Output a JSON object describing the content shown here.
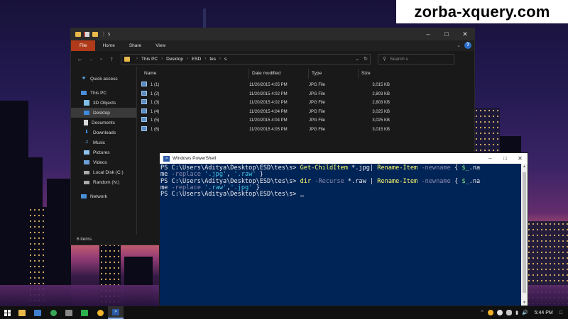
{
  "watermark": "zorba-xquery.com",
  "explorer": {
    "title": "s",
    "ribbon_tabs": [
      "File",
      "Home",
      "Share",
      "View"
    ],
    "help_label": "?",
    "breadcrumb": [
      "This PC",
      "Desktop",
      "ESD",
      "tes",
      "s"
    ],
    "search_placeholder": "Search s",
    "sidebar": [
      {
        "label": "Quick access",
        "icon": "star-icon"
      },
      {
        "label": "This PC",
        "icon": "computer-icon"
      },
      {
        "label": "3D Objects",
        "icon": "cube-icon"
      },
      {
        "label": "Desktop",
        "icon": "desktop-icon",
        "selected": true
      },
      {
        "label": "Documents",
        "icon": "document-icon"
      },
      {
        "label": "Downloads",
        "icon": "download-icon"
      },
      {
        "label": "Music",
        "icon": "music-icon"
      },
      {
        "label": "Pictures",
        "icon": "picture-icon"
      },
      {
        "label": "Videos",
        "icon": "video-icon"
      },
      {
        "label": "Local Disk (C:)",
        "icon": "drive-icon"
      },
      {
        "label": "Random (N:)",
        "icon": "drive-icon"
      },
      {
        "label": "Network",
        "icon": "network-icon"
      }
    ],
    "columns": {
      "name": "Name",
      "date": "Date modified",
      "type": "Type",
      "size": "Size"
    },
    "files": [
      {
        "name": "1 (1)",
        "date": "11/20/2015 4:05 PM",
        "type": "JPG File",
        "size": "3,015 KB"
      },
      {
        "name": "1 (2)",
        "date": "11/20/2015 4:02 PM",
        "type": "JPG File",
        "size": "2,803 KB"
      },
      {
        "name": "1 (3)",
        "date": "11/20/2015 4:02 PM",
        "type": "JPG File",
        "size": "2,803 KB"
      },
      {
        "name": "1 (4)",
        "date": "11/20/2015 4:04 PM",
        "type": "JPG File",
        "size": "3,025 KB"
      },
      {
        "name": "1 (5)",
        "date": "11/20/2015 4:04 PM",
        "type": "JPG File",
        "size": "3,025 KB"
      },
      {
        "name": "1 (6)",
        "date": "11/20/2015 4:05 PM",
        "type": "JPG File",
        "size": "3,015 KB"
      }
    ],
    "status": "6 items"
  },
  "powershell": {
    "title": "Windows PowerShell",
    "prompt": "PS C:\\Users\\Aditya\\Desktop\\ESD\\tes\\s> ",
    "line1": {
      "cmd": "Get-ChildItem",
      "arg": " *.jpg| ",
      "cmd2": "Rename-Item",
      "param": " -newname",
      "rest": " { ",
      "var": "$_",
      "tail": ".na"
    },
    "line1_wrap": {
      "text": "me ",
      "param": "-replace",
      "sp": " ",
      "str1": "'.jpg'",
      "comma": ", ",
      "str2": "'.raw'",
      "end": " }"
    },
    "line2": {
      "cmd": "dir",
      "param": " -Recurse",
      "arg": " *.raw | ",
      "cmd2": "Rename-Item",
      "param2": " -newname",
      "rest": " { ",
      "var": "$_",
      "tail": ".na"
    },
    "line2_wrap": {
      "text": "me ",
      "param": "-replace",
      "sp": " ",
      "str1": "'.raw'",
      "comma": ",",
      "str2": "'.jpg'",
      "end": " }"
    }
  },
  "taskbar": {
    "time": "5:44 PM",
    "apps": [
      "file-explorer-icon",
      "photos-icon",
      "chrome-icon",
      "calculator-icon",
      "chat-icon",
      "settings-icon",
      "powershell-icon"
    ]
  },
  "colors": {
    "ps_background": "#012456",
    "ps_command": "#ffff6a",
    "ps_string": "#45c4e4",
    "ps_param": "#8a8ab0",
    "file_tab": "#b03a1a"
  }
}
